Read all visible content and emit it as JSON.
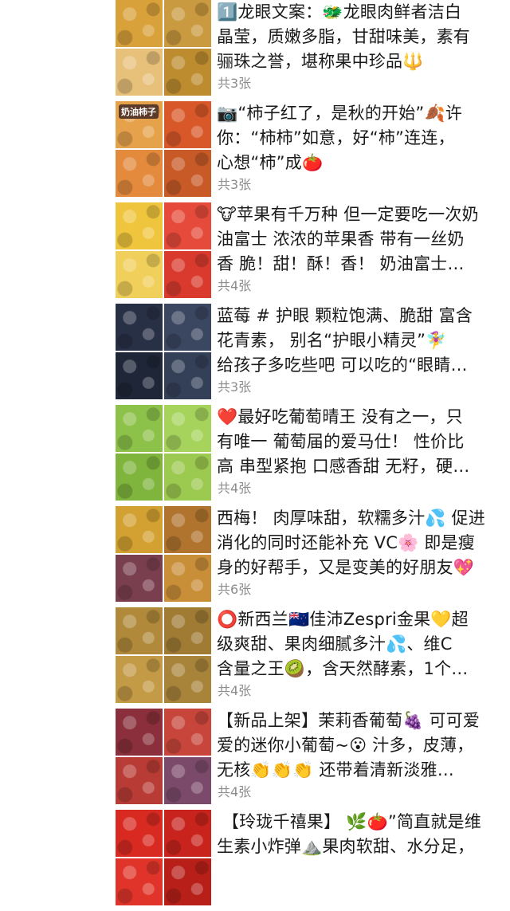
{
  "posts": [
    {
      "caption": "1️⃣龙眼文案：🐲龙眼肉鲜者洁白\n晶莹，质嫩多脂，甘甜味美，素有\n骊珠之誉，堪称果中珍品🔱",
      "count": "共3张",
      "thumbs": [
        "#d9a13a",
        "#c99a3f",
        "#e7c07a",
        "#bd8c2f"
      ]
    },
    {
      "caption": "📷“柿子红了，是秋的开始”🍂许\n你：“柿柿”如意，好“柿”连连，\n心想“柿”成🍅",
      "count": "共3张",
      "badge": "奶油柿子",
      "thumbs": [
        "#e6a14b",
        "#d8582a",
        "#e38a3c",
        "#c85a27"
      ]
    },
    {
      "caption": "🐮苹果有千万种 但一定要吃一次奶\n油富士 浓浓的苹果香 带有一丝奶\n香 脆！甜！酥！香！ 奶油富士…",
      "count": "共4张",
      "thumbs": [
        "#efc53d",
        "#e64a3a",
        "#f0cf5a",
        "#d93a2d"
      ]
    },
    {
      "caption": "蓝莓 # 护眼 颗粒饱满、脆甜 富含\n花青素， 别名“护眼小精灵”🧚‍♀️\n给孩子多吃些吧 可以吃的“眼睛…",
      "count": "共3张",
      "thumbs": [
        "#283046",
        "#3b4660",
        "#1f2638",
        "#344058"
      ]
    },
    {
      "caption": "❤️最好吃葡萄晴王 没有之一，只\n有唯一 葡萄届的爱马仕！ 性价比\n高 串型紧抱 口感香甜 无籽，硬…",
      "count": "共4张",
      "thumbs": [
        "#8dc24a",
        "#a6d35c",
        "#7fb53d",
        "#9cc94f"
      ]
    },
    {
      "caption": "西梅！ 肉厚味甜，软糯多汁💦 促进\n消化的同时还能补充 VC🌸 即是瘦\n身的好帮手，又是变美的好朋友💖",
      "count": "共6张",
      "thumbs": [
        "#d3a131",
        "#b0742e",
        "#7a3f4f",
        "#c98e38"
      ]
    },
    {
      "caption": "⭕新西兰🇳🇿佳沛Zespri金果💛超\n级爽甜、果肉细腻多汁💦、维C\n含量之王🥝，含天然酵素，1个…",
      "count": "共4张",
      "thumbs": [
        "#b08a3a",
        "#9f7b34",
        "#c39a45",
        "#a8843b"
      ]
    },
    {
      "caption": "【新品上架】茉莉香葡萄🍇 可可爱\n爱的迷你小葡萄~😮 汁多，皮薄，\n无核👏👏👏 还带着清新淡雅…",
      "count": "共4张",
      "thumbs": [
        "#8a2f3b",
        "#c7453a",
        "#b93b35",
        "#7b4a6a"
      ]
    },
    {
      "caption": " 【玲珑千禧果】 🌿🍅”简直就是维\n生素小炸弹⛰️果肉软甜、水分足，",
      "count": "",
      "thumbs": [
        "#d92a22",
        "#c8231c",
        "#e0342a",
        "#b81f19"
      ]
    }
  ]
}
